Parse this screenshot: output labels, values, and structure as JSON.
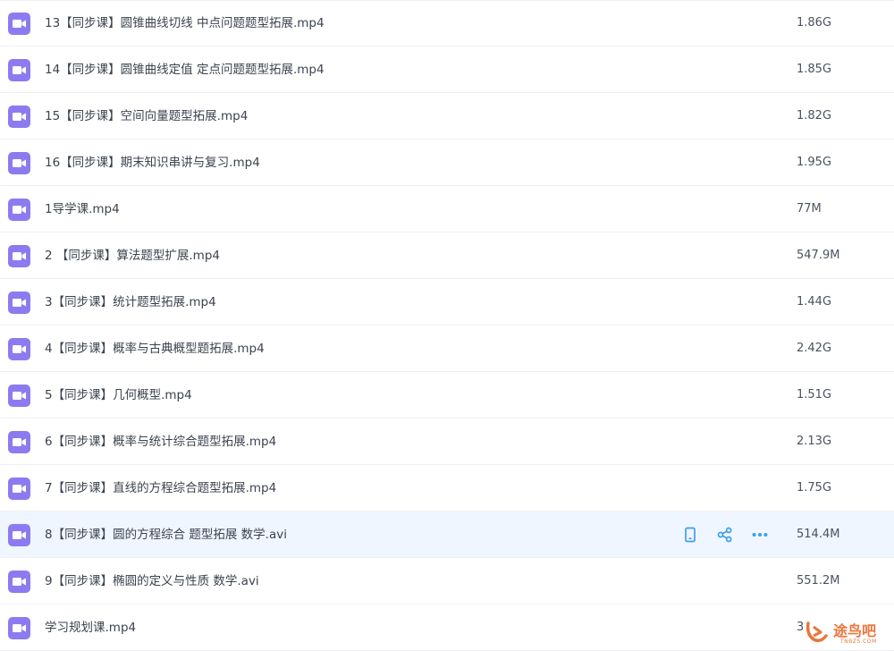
{
  "files": [
    {
      "name": "13【同步课】圆锥曲线切线 中点问题题型拓展.mp4",
      "size": "1.86G"
    },
    {
      "name": "14【同步课】圆锥曲线定值 定点问题题型拓展.mp4",
      "size": "1.85G"
    },
    {
      "name": "15【同步课】空间向量题型拓展.mp4",
      "size": "1.82G"
    },
    {
      "name": "16【同步课】期末知识串讲与复习.mp4",
      "size": "1.95G"
    },
    {
      "name": "1导学课.mp4",
      "size": "77M"
    },
    {
      "name": "2 【同步课】算法题型扩展.mp4",
      "size": "547.9M"
    },
    {
      "name": "3【同步课】统计题型拓展.mp4",
      "size": "1.44G"
    },
    {
      "name": "4【同步课】概率与古典概型题拓展.mp4",
      "size": "2.42G"
    },
    {
      "name": "5【同步课】几何概型.mp4",
      "size": "1.51G"
    },
    {
      "name": "6【同步课】概率与统计综合题型拓展.mp4",
      "size": "2.13G"
    },
    {
      "name": "7【同步课】直线的方程综合题型拓展.mp4",
      "size": "1.75G"
    },
    {
      "name": "8【同步课】圆的方程综合 题型拓展 数学.avi",
      "size": "514.4M"
    },
    {
      "name": "9【同步课】椭圆的定义与性质 数学.avi",
      "size": "551.2M"
    },
    {
      "name": "学习规划课.mp4",
      "size": "3"
    }
  ],
  "hover_row_index": 11,
  "file_icon": "video-file-icon",
  "colors": {
    "icon_purple": "#8c7bf0",
    "action_blue": "#3a9ee8",
    "hover_bg": "#f0f6ff",
    "watermark": "#e8763c"
  },
  "watermark": {
    "text": "途鸟吧",
    "sub": "TNBZS.COM"
  }
}
